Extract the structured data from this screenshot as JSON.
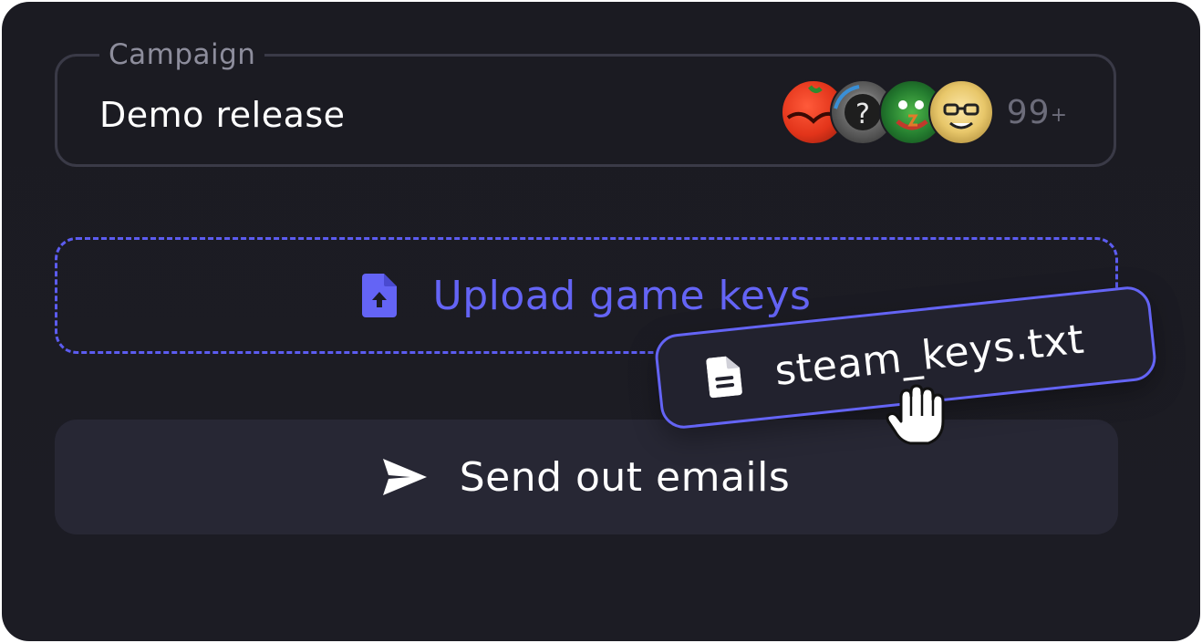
{
  "campaign": {
    "label": "Campaign",
    "value": "Demo release",
    "avatars": [
      {
        "icon": "red-tomato-character-avatar"
      },
      {
        "icon": "hooded-figure-question-mark-avatar"
      },
      {
        "icon": "green-goblin-monster-avatar"
      },
      {
        "icon": "bald-man-glasses-avatar"
      }
    ],
    "count_main": "99",
    "count_suffix": "+"
  },
  "upload": {
    "label": "Upload game keys",
    "icon": "file-upload-icon",
    "color": "#6464f5"
  },
  "send": {
    "label": "Send out emails",
    "icon": "send-paper-plane-icon"
  },
  "dragged_file": {
    "name": "steam_keys.txt",
    "icon": "document-icon",
    "cursor": "grab-hand-cursor-icon"
  },
  "colors": {
    "background": "#1b1b22",
    "accent": "#6464f5",
    "button": "#272734",
    "border": "#3a3a47"
  }
}
